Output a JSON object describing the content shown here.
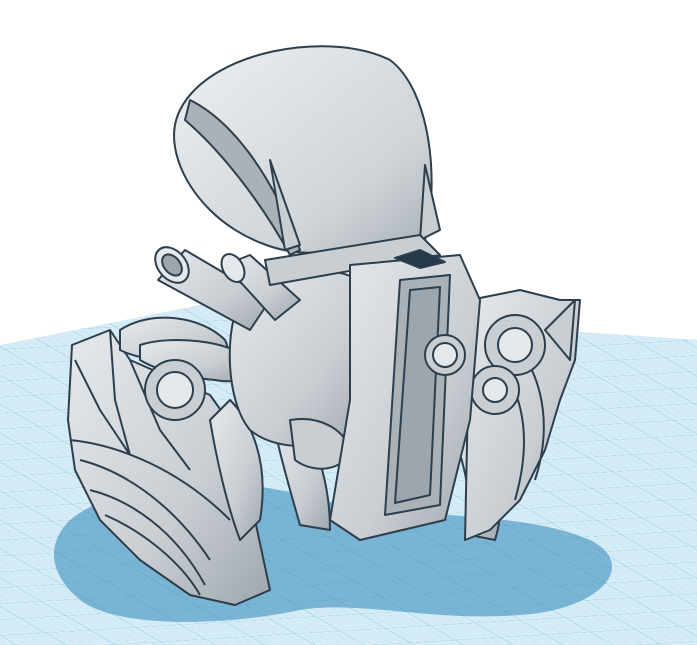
{
  "viewport": {
    "background": "#ffffff",
    "grid": {
      "visible": true,
      "minor_color": "#b9dcea",
      "major_color": "#7fc0dc",
      "plane_color": "#d6edf7"
    },
    "shadow_color": "#2f86b8"
  },
  "model": {
    "fill_color": "#c9ced3",
    "highlight_color": "#e6e9ec",
    "shade_color": "#9ea6ad",
    "edge_color": "#2d3e4d",
    "dark_detail_color": "#25394b"
  }
}
